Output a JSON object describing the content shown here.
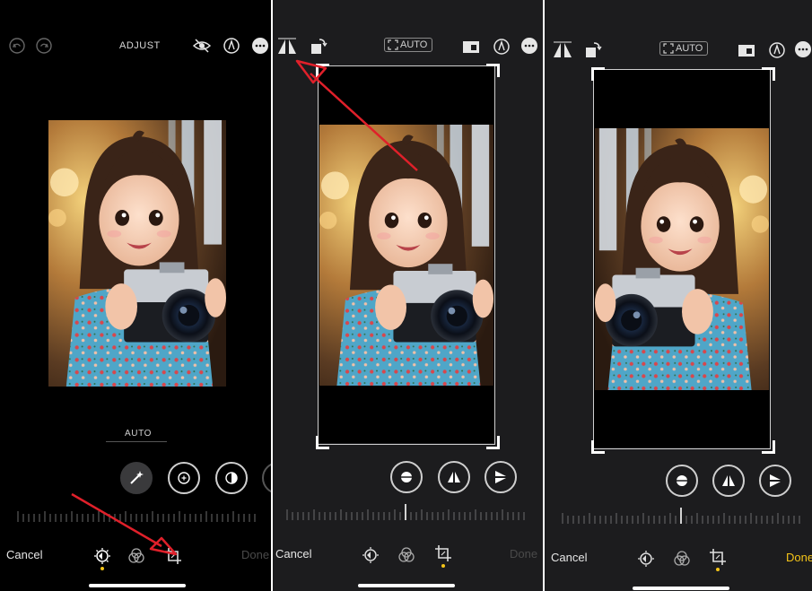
{
  "colors": {
    "accent_yellow": "#f5c518",
    "annotation_red": "#e0202a",
    "panel_bg_black": "#000000",
    "panel_bg_dark": "#1c1c1e"
  },
  "panel1": {
    "title": "ADJUST",
    "top_icons": [
      "undo-icon",
      "redo-icon",
      "eye-icon",
      "markup-icon",
      "more-icon"
    ],
    "auto_label": "AUTO",
    "tool_buttons": [
      "magic-wand-icon",
      "exposure-icon",
      "brilliance-icon"
    ],
    "cancel": "Cancel",
    "done": "Done",
    "bottom_tabs": [
      "adjust-icon",
      "filters-icon",
      "crop-icon"
    ],
    "active_tab": "adjust-icon"
  },
  "panel2": {
    "auto_label": "AUTO",
    "top_icons": [
      "perspective-icon",
      "rotate-icon",
      "aspect-ratio-icon",
      "markup-icon",
      "more-icon"
    ],
    "tool_buttons": [
      "straighten-icon",
      "vertical-perspective-icon",
      "horizontal-perspective-icon"
    ],
    "cancel": "Cancel",
    "done": "Done",
    "bottom_tabs": [
      "adjust-icon",
      "filters-icon",
      "crop-icon"
    ],
    "active_tab": "crop-icon"
  },
  "panel3": {
    "auto_label": "AUTO",
    "top_icons": [
      "perspective-icon",
      "rotate-icon",
      "aspect-ratio-icon",
      "markup-icon",
      "more-icon"
    ],
    "tool_buttons": [
      "straighten-icon",
      "vertical-perspective-icon",
      "horizontal-perspective-icon"
    ],
    "cancel": "Cancel",
    "done": "Done",
    "done_active": true,
    "bottom_tabs": [
      "adjust-icon",
      "filters-icon",
      "crop-icon"
    ],
    "active_tab": "crop-icon",
    "image_flipped": true
  }
}
